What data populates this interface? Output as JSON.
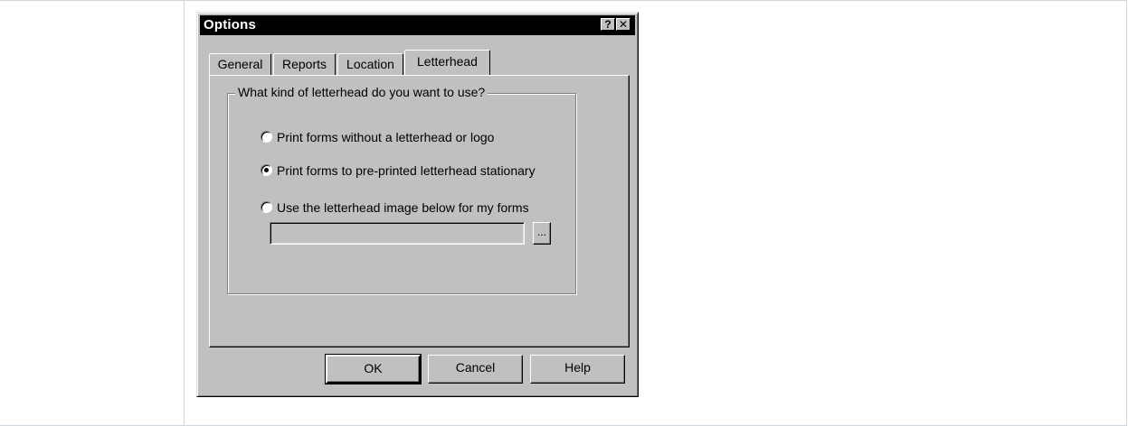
{
  "dialog": {
    "title": "Options",
    "help_caption": "?",
    "close_caption": "✕"
  },
  "tabs": [
    {
      "label": "General",
      "active": false
    },
    {
      "label": "Reports",
      "active": false
    },
    {
      "label": "Location",
      "active": false
    },
    {
      "label": "Letterhead",
      "active": true
    }
  ],
  "letterhead": {
    "group_label": "What kind of letterhead do you want to use?",
    "options": [
      {
        "label": "Print forms without a letterhead or logo",
        "selected": false
      },
      {
        "label": "Print forms to pre-printed letterhead stationary",
        "selected": true
      },
      {
        "label": "Use the letterhead image below for my forms",
        "selected": false
      }
    ],
    "image_path_value": "",
    "browse_label": "..."
  },
  "buttons": {
    "ok": "OK",
    "cancel": "Cancel",
    "help": "Help"
  }
}
